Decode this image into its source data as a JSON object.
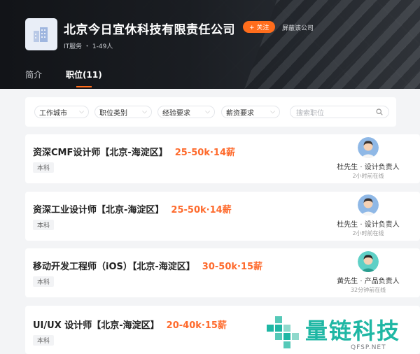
{
  "company": {
    "name": "北京今日宜休科技有限责任公司",
    "follow_label": "+ 关注",
    "block_label": "屏蔽该公司",
    "meta": "IT服务 ・ 1-49人"
  },
  "tabs": [
    {
      "label": "简介",
      "active": false
    },
    {
      "label": "职位(11)",
      "active": true
    }
  ],
  "filters": {
    "city": "工作城市",
    "category": "职位类别",
    "experience": "经验要求",
    "salary": "薪资要求",
    "search_placeholder": "搜索职位"
  },
  "jobs": [
    {
      "title": "资深CMF设计师【北京-海淀区】",
      "salary": "25-50k·14薪",
      "education": "本科",
      "recruiter_name": "杜先生 · 设计负责人",
      "recruiter_status": "2小时前在线"
    },
    {
      "title": "资深工业设计师【北京-海淀区】",
      "salary": "25-50k·14薪",
      "education": "本科",
      "recruiter_name": "杜先生 · 设计负责人",
      "recruiter_status": "2小时前在线"
    },
    {
      "title": "移动开发工程师（iOS）【北京-海淀区】",
      "salary": "30-50k·15薪",
      "education": "本科",
      "recruiter_name": "黄先生 · 产品负责人",
      "recruiter_status": "32分钟前在线"
    },
    {
      "title": "UI/UX 设计师【北京-海淀区】",
      "salary": "20-40k·15薪",
      "education": "本科"
    }
  ],
  "watermark": {
    "text": "量链科技",
    "sub": "QFSP.NET"
  },
  "colors": {
    "accent": "#ff6d1c",
    "salary": "#fe6a2c",
    "watermark": "#1fb7a4"
  }
}
